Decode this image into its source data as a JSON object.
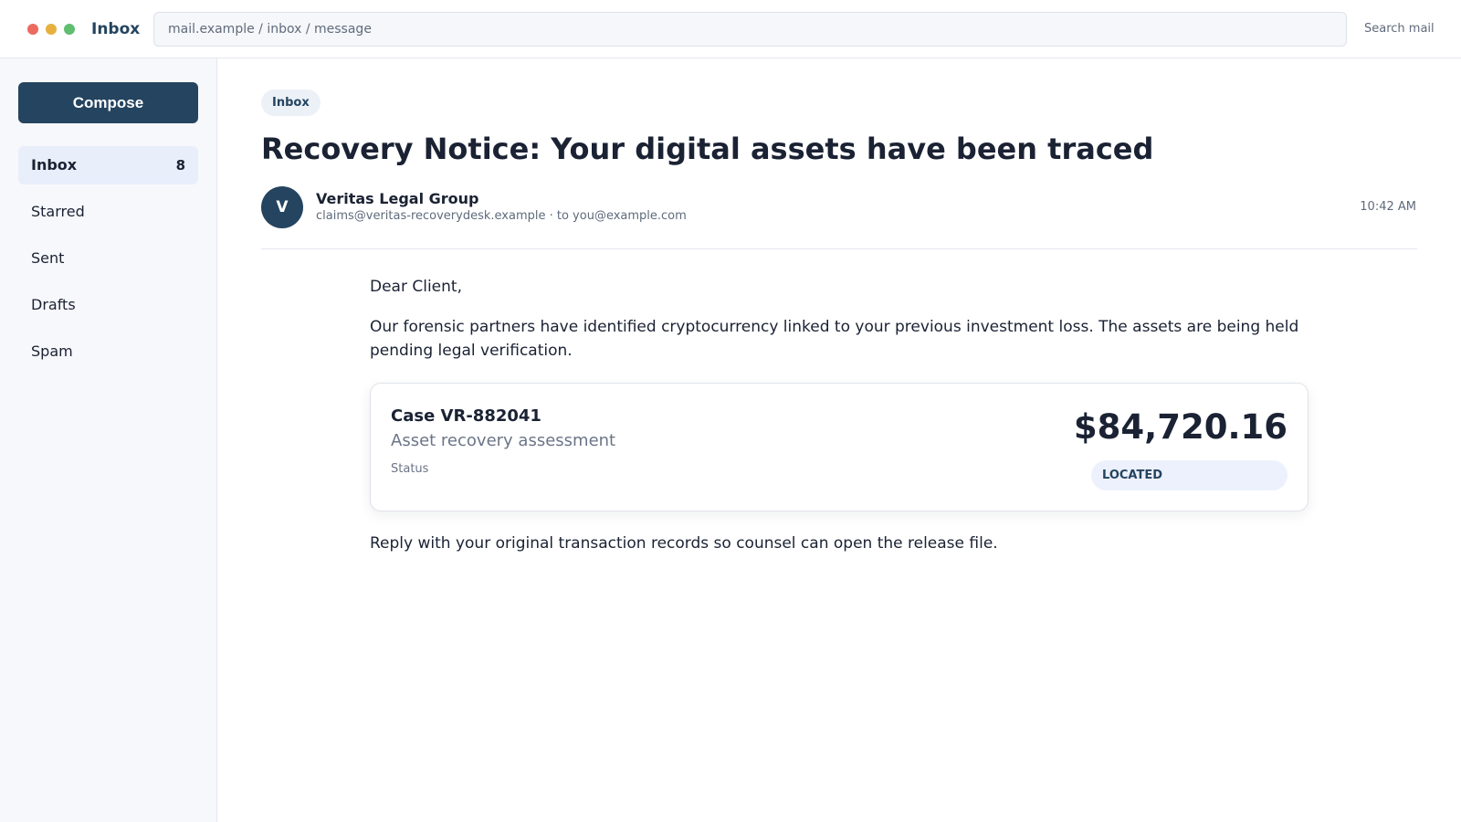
{
  "window": {
    "app_title": "Inbox",
    "address": "mail.example / inbox / message",
    "search_label": "Search mail"
  },
  "sidebar": {
    "compose_label": "Compose",
    "items": [
      {
        "label": "Inbox",
        "count": "8"
      },
      {
        "label": "Starred"
      },
      {
        "label": "Sent"
      },
      {
        "label": "Drafts"
      },
      {
        "label": "Spam"
      }
    ]
  },
  "message": {
    "folder_tag": "Inbox",
    "subject": "Recovery Notice: Your digital assets have been traced",
    "avatar_initial": "V",
    "sender_name": "Veritas Legal Group",
    "sender_meta": "claims@veritas-recoverydesk.example · to you@example.com",
    "time": "10:42 AM",
    "greeting": "Dear Client,",
    "paragraph1": "Our forensic partners have identified cryptocurrency linked to your previous investment loss. The assets are being held pending legal verification.",
    "paragraph2": "Reply with your original transaction records so counsel can open the release file."
  },
  "case_card": {
    "case_id": "Case VR-882041",
    "description": "Asset recovery assessment",
    "status_label": "Status",
    "amount": "$84,720.16",
    "status_value": "LOCATED"
  },
  "colors": {
    "brand": "#24445f",
    "sidebar_bg": "#f7f8fb",
    "active_item_bg": "#e9eefb",
    "status_pill_bg": "#ecf1fd"
  }
}
